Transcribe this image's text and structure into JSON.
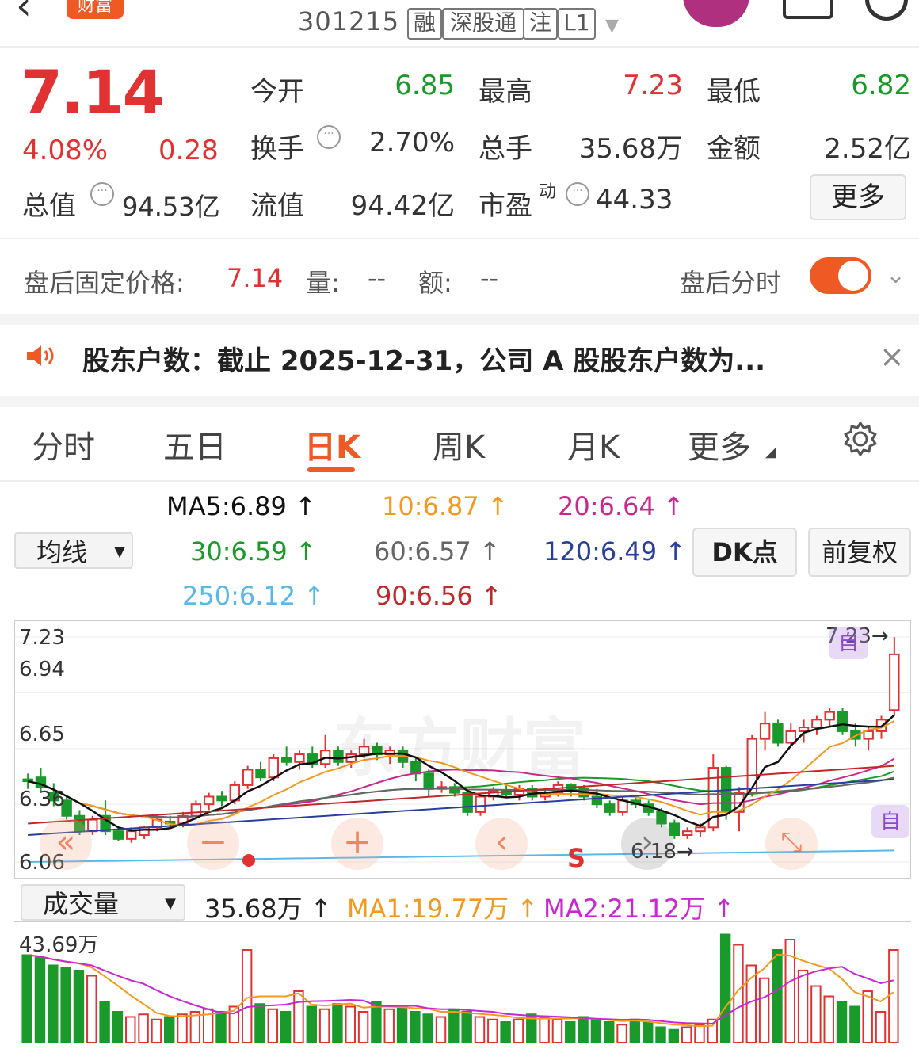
{
  "header": {
    "back_icon": "back-chevron-icon",
    "brand": "财富",
    "code": "301215",
    "tags": [
      "融",
      "深股通",
      "注",
      "L1"
    ]
  },
  "quote": {
    "price": "7.14",
    "change_pct": "4.08%",
    "change": "0.28",
    "open_label": "今开",
    "open": "6.85",
    "high_label": "最高",
    "high": "7.23",
    "low_label": "最低",
    "low": "6.82",
    "turnover_label": "换手",
    "turnover": "2.70%",
    "volume_label": "总手",
    "volume": "35.68万",
    "amount_label": "金额",
    "amount": "2.52亿",
    "mcap_label": "总值",
    "mcap": "94.53亿",
    "float_label": "流值",
    "float": "94.42亿",
    "pe_label": "市盈",
    "pe_sup": "动",
    "pe": "44.33",
    "more": "更多",
    "colors": {
      "up": "#e03232",
      "down": "#1a9a2a"
    }
  },
  "afterhours": {
    "label": "盘后固定价格:",
    "price": "7.14",
    "vol_label": "量:",
    "vol": "--",
    "amt_label": "额:",
    "amt": "--",
    "switch_label": "盘后分时",
    "switch_on": true
  },
  "news": {
    "text": "股东户数：截止 2025-12-31，公司 A 股股东户数为..."
  },
  "tabs": [
    {
      "label": "分时"
    },
    {
      "label": "五日"
    },
    {
      "label": "日K",
      "active": true
    },
    {
      "label": "周K"
    },
    {
      "label": "月K"
    },
    {
      "label": "更多"
    }
  ],
  "ma_select": "均线",
  "ma": {
    "ma5": "MA5:6.89",
    "ma10": "10:6.87",
    "ma20": "20:6.64",
    "ma30": "30:6.59",
    "ma60": "60:6.57",
    "ma120": "120:6.49",
    "ma250": "250:6.12",
    "ma90": "90:6.56"
  },
  "ma_colors": {
    "ma5": "#111111",
    "ma10": "#f39a1e",
    "ma20": "#c8288c",
    "ma30": "#1a9a2a",
    "ma60": "#666666",
    "ma120": "#2a3f9c",
    "ma250": "#5ab8e8",
    "ma90": "#c0282a"
  },
  "dk_label": "DK点",
  "fq_label": "前复权",
  "kchart": {
    "ylabels": [
      "7.23",
      "6.94",
      "6.65",
      "6.36",
      "6.06"
    ],
    "max_label": "7.23",
    "min_label": "6.18",
    "watermark": "东方财富",
    "zi": "自",
    "s_mark": "S"
  },
  "vol_select": "成交量",
  "volume": {
    "value": "35.68万",
    "ma1": "MA1:19.77万",
    "ma2": "MA2:21.12万",
    "max_label": "43.69万"
  },
  "chart_data": {
    "type": "candlestick",
    "ohlc": [
      [
        6.49,
        6.52,
        6.44,
        6.48
      ],
      [
        6.5,
        6.55,
        6.42,
        6.45
      ],
      [
        6.42,
        6.47,
        6.35,
        6.38
      ],
      [
        6.38,
        6.4,
        6.28,
        6.3
      ],
      [
        6.3,
        6.33,
        6.2,
        6.22
      ],
      [
        6.22,
        6.3,
        6.2,
        6.28
      ],
      [
        6.3,
        6.38,
        6.2,
        6.22
      ],
      [
        6.22,
        6.24,
        6.17,
        6.18
      ],
      [
        6.18,
        6.24,
        6.16,
        6.22
      ],
      [
        6.2,
        6.25,
        6.18,
        6.24
      ],
      [
        6.24,
        6.3,
        6.22,
        6.28
      ],
      [
        6.27,
        6.3,
        6.24,
        6.26
      ],
      [
        6.26,
        6.32,
        6.24,
        6.3
      ],
      [
        6.3,
        6.38,
        6.28,
        6.36
      ],
      [
        6.36,
        6.42,
        6.33,
        6.4
      ],
      [
        6.4,
        6.43,
        6.35,
        6.38
      ],
      [
        6.38,
        6.48,
        6.36,
        6.46
      ],
      [
        6.46,
        6.56,
        6.44,
        6.54
      ],
      [
        6.54,
        6.58,
        6.48,
        6.5
      ],
      [
        6.5,
        6.62,
        6.48,
        6.6
      ],
      [
        6.6,
        6.66,
        6.56,
        6.58
      ],
      [
        6.58,
        6.64,
        6.54,
        6.62
      ],
      [
        6.62,
        6.66,
        6.55,
        6.57
      ],
      [
        6.57,
        6.72,
        6.55,
        6.64
      ],
      [
        6.64,
        6.66,
        6.56,
        6.58
      ],
      [
        6.58,
        6.64,
        6.55,
        6.62
      ],
      [
        6.62,
        6.7,
        6.6,
        6.66
      ],
      [
        6.66,
        6.68,
        6.59,
        6.62
      ],
      [
        6.62,
        6.66,
        6.57,
        6.64
      ],
      [
        6.64,
        6.66,
        6.55,
        6.58
      ],
      [
        6.58,
        6.6,
        6.48,
        6.52
      ],
      [
        6.52,
        6.54,
        6.4,
        6.44
      ],
      [
        6.44,
        6.48,
        6.42,
        6.45
      ],
      [
        6.45,
        6.47,
        6.4,
        6.42
      ],
      [
        6.42,
        6.44,
        6.3,
        6.32
      ],
      [
        6.32,
        6.42,
        6.3,
        6.4
      ],
      [
        6.4,
        6.45,
        6.38,
        6.43
      ],
      [
        6.43,
        6.47,
        6.4,
        6.41
      ],
      [
        6.41,
        6.46,
        6.38,
        6.44
      ],
      [
        6.44,
        6.46,
        6.38,
        6.4
      ],
      [
        6.4,
        6.44,
        6.38,
        6.42
      ],
      [
        6.42,
        6.48,
        6.4,
        6.46
      ],
      [
        6.46,
        6.47,
        6.4,
        6.44
      ],
      [
        6.44,
        6.46,
        6.38,
        6.4
      ],
      [
        6.4,
        6.44,
        6.34,
        6.36
      ],
      [
        6.36,
        6.38,
        6.3,
        6.32
      ],
      [
        6.32,
        6.4,
        6.3,
        6.38
      ],
      [
        6.38,
        6.4,
        6.34,
        6.36
      ],
      [
        6.36,
        6.38,
        6.3,
        6.32
      ],
      [
        6.32,
        6.34,
        6.24,
        6.26
      ],
      [
        6.26,
        6.28,
        6.18,
        6.2
      ],
      [
        6.2,
        6.24,
        6.18,
        6.22
      ],
      [
        6.22,
        6.26,
        6.19,
        6.24
      ],
      [
        6.24,
        6.62,
        6.22,
        6.55
      ],
      [
        6.55,
        6.56,
        6.28,
        6.32
      ],
      [
        6.32,
        6.45,
        6.22,
        6.42
      ],
      [
        6.42,
        6.72,
        6.4,
        6.7
      ],
      [
        6.7,
        6.84,
        6.64,
        6.78
      ],
      [
        6.78,
        6.8,
        6.66,
        6.68
      ],
      [
        6.68,
        6.78,
        6.66,
        6.74
      ],
      [
        6.74,
        6.8,
        6.68,
        6.76
      ],
      [
        6.76,
        6.82,
        6.72,
        6.8
      ],
      [
        6.8,
        6.86,
        6.76,
        6.84
      ],
      [
        6.84,
        6.86,
        6.72,
        6.74
      ],
      [
        6.74,
        6.78,
        6.66,
        6.7
      ],
      [
        6.7,
        6.76,
        6.64,
        6.74
      ],
      [
        6.74,
        6.82,
        6.7,
        6.8
      ],
      [
        6.85,
        7.23,
        6.82,
        7.14
      ]
    ],
    "volumes": [
      34,
      33,
      30,
      29,
      28,
      26,
      16,
      12,
      10,
      11,
      9,
      10,
      11,
      12,
      13,
      12,
      14,
      36,
      15,
      13,
      12,
      20,
      14,
      13,
      15,
      14,
      12,
      16,
      13,
      14,
      12,
      11,
      10,
      13,
      12,
      10,
      9,
      8,
      9,
      11,
      10,
      9,
      8,
      10,
      9,
      8,
      7,
      9,
      8,
      6,
      5,
      6,
      7,
      9,
      42,
      38,
      30,
      25,
      36,
      40,
      28,
      22,
      18,
      16,
      14,
      20,
      12,
      36
    ],
    "ylim": [
      6.06,
      7.23
    ],
    "yticks": [
      "7.23",
      "6.94",
      "6.65",
      "6.36",
      "6.06"
    ],
    "high_label": "7.23",
    "low_label": "6.18",
    "volume_max_label": "43.69万"
  }
}
